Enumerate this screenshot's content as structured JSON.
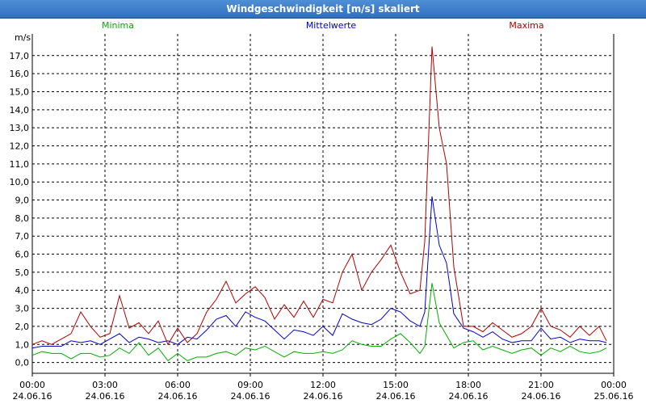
{
  "window": {
    "title": "Windgeschwindigkeit [m/s] skaliert"
  },
  "chart_data": {
    "type": "line",
    "title": "Windgeschwindigkeit [m/s] skaliert",
    "ylabel": "m/s",
    "xlabel": "",
    "ylim": [
      -0.6,
      18.2
    ],
    "yticks": [
      0,
      1,
      2,
      3,
      4,
      5,
      6,
      7,
      8,
      9,
      10,
      11,
      12,
      13,
      14,
      15,
      16,
      17
    ],
    "ytick_labels": [
      "0,0",
      "1,0",
      "2,0",
      "3,0",
      "4,0",
      "5,0",
      "6,0",
      "7,0",
      "8,0",
      "9,0",
      "10,0",
      "11,0",
      "12,0",
      "13,0",
      "14,0",
      "15,0",
      "16,0",
      "17,0"
    ],
    "xlim": [
      0,
      24
    ],
    "xticks": [
      0,
      3,
      6,
      9,
      12,
      15,
      18,
      21,
      24
    ],
    "xtick_times": [
      "00:00",
      "03:00",
      "06:00",
      "09:00",
      "12:00",
      "15:00",
      "18:00",
      "21:00",
      "00:00"
    ],
    "xtick_dates": [
      "24.06.16",
      "24.06.16",
      "24.06.16",
      "24.06.16",
      "24.06.16",
      "24.06.16",
      "24.06.16",
      "24.06.16",
      "25.06.16"
    ],
    "grid": true,
    "series": [
      {
        "name": "Minima",
        "color": "#00b000",
        "legend_position": "left",
        "x": [
          0,
          0.4,
          0.8,
          1.2,
          1.6,
          2.0,
          2.4,
          2.8,
          3.2,
          3.6,
          4.0,
          4.4,
          4.8,
          5.2,
          5.6,
          6.0,
          6.4,
          6.8,
          7.2,
          7.6,
          8.0,
          8.4,
          8.8,
          9.2,
          9.6,
          10.0,
          10.4,
          10.8,
          11.2,
          11.6,
          12.0,
          12.4,
          12.8,
          13.2,
          13.6,
          14.0,
          14.4,
          14.8,
          15.2,
          15.6,
          16.0,
          16.2,
          16.5,
          16.8,
          17.1,
          17.4,
          17.8,
          18.2,
          18.6,
          19.0,
          19.4,
          19.8,
          20.2,
          20.6,
          21.0,
          21.4,
          21.8,
          22.2,
          22.6,
          23.0,
          23.4,
          23.7
        ],
        "y": [
          0.4,
          0.6,
          0.5,
          0.5,
          0.2,
          0.5,
          0.5,
          0.3,
          0.4,
          0.8,
          0.5,
          1.1,
          0.4,
          0.8,
          0.1,
          0.5,
          0.1,
          0.3,
          0.3,
          0.5,
          0.6,
          0.4,
          0.8,
          0.7,
          0.9,
          0.6,
          0.3,
          0.6,
          0.5,
          0.5,
          0.6,
          0.5,
          0.7,
          1.2,
          1.0,
          0.9,
          0.9,
          1.3,
          1.6,
          1.1,
          0.5,
          0.9,
          4.4,
          2.2,
          1.5,
          0.8,
          1.1,
          1.2,
          0.7,
          0.9,
          0.7,
          0.5,
          0.7,
          0.8,
          0.4,
          0.8,
          0.6,
          0.9,
          0.6,
          0.5,
          0.6,
          0.8
        ]
      },
      {
        "name": "Mittelwerte",
        "color": "#0000c8",
        "legend_position": "center",
        "x": [
          0,
          0.4,
          0.8,
          1.2,
          1.6,
          2.0,
          2.4,
          2.8,
          3.2,
          3.6,
          4.0,
          4.4,
          4.8,
          5.2,
          5.6,
          6.0,
          6.4,
          6.8,
          7.2,
          7.6,
          8.0,
          8.4,
          8.8,
          9.2,
          9.6,
          10.0,
          10.4,
          10.8,
          11.2,
          11.6,
          12.0,
          12.4,
          12.8,
          13.2,
          13.6,
          14.0,
          14.4,
          14.8,
          15.2,
          15.6,
          16.0,
          16.2,
          16.5,
          16.8,
          17.1,
          17.4,
          17.8,
          18.2,
          18.6,
          19.0,
          19.4,
          19.8,
          20.2,
          20.6,
          21.0,
          21.4,
          21.8,
          22.2,
          22.6,
          23.0,
          23.4,
          23.7
        ],
        "y": [
          0.8,
          0.9,
          0.9,
          0.9,
          1.2,
          1.1,
          1.2,
          1.0,
          1.3,
          1.6,
          1.1,
          1.4,
          1.3,
          1.1,
          1.2,
          1.0,
          1.4,
          1.3,
          1.8,
          2.4,
          2.6,
          2.0,
          2.8,
          2.5,
          2.3,
          1.8,
          1.3,
          1.8,
          1.7,
          1.5,
          2.0,
          1.5,
          2.7,
          2.4,
          2.2,
          2.1,
          2.4,
          3.0,
          2.8,
          2.3,
          2.0,
          2.8,
          9.2,
          6.5,
          5.5,
          2.7,
          1.9,
          1.7,
          1.4,
          1.7,
          1.3,
          1.1,
          1.2,
          1.2,
          1.9,
          1.3,
          1.4,
          1.1,
          1.3,
          1.2,
          1.2,
          1.1
        ]
      },
      {
        "name": "Maxima",
        "color": "#b00000",
        "legend_position": "right",
        "x": [
          0,
          0.4,
          0.8,
          1.2,
          1.6,
          2.0,
          2.4,
          2.8,
          3.2,
          3.6,
          4.0,
          4.4,
          4.8,
          5.2,
          5.6,
          6.0,
          6.4,
          6.8,
          7.2,
          7.6,
          8.0,
          8.4,
          8.8,
          9.2,
          9.6,
          10.0,
          10.4,
          10.8,
          11.2,
          11.6,
          12.0,
          12.4,
          12.8,
          13.2,
          13.6,
          14.0,
          14.4,
          14.8,
          15.2,
          15.6,
          16.0,
          16.2,
          16.5,
          16.8,
          17.1,
          17.4,
          17.8,
          18.2,
          18.6,
          19.0,
          19.4,
          19.8,
          20.2,
          20.6,
          21.0,
          21.4,
          21.8,
          22.2,
          22.6,
          23.0,
          23.4,
          23.7
        ],
        "y": [
          1.0,
          1.2,
          1.0,
          1.3,
          1.6,
          2.8,
          2.0,
          1.4,
          1.6,
          3.7,
          1.9,
          2.2,
          1.6,
          2.3,
          1.0,
          1.9,
          1.1,
          1.6,
          2.8,
          3.5,
          4.5,
          3.3,
          3.8,
          4.2,
          3.6,
          2.4,
          3.2,
          2.5,
          3.4,
          2.5,
          3.5,
          3.3,
          5.0,
          6.0,
          4.0,
          5.0,
          5.7,
          6.5,
          5.0,
          3.8,
          4.0,
          6.7,
          17.5,
          13.0,
          11.0,
          5.3,
          2.0,
          2.0,
          1.7,
          2.2,
          1.8,
          1.4,
          1.6,
          2.0,
          3.0,
          2.0,
          1.8,
          1.4,
          2.0,
          1.5,
          2.0,
          1.2
        ]
      }
    ]
  }
}
